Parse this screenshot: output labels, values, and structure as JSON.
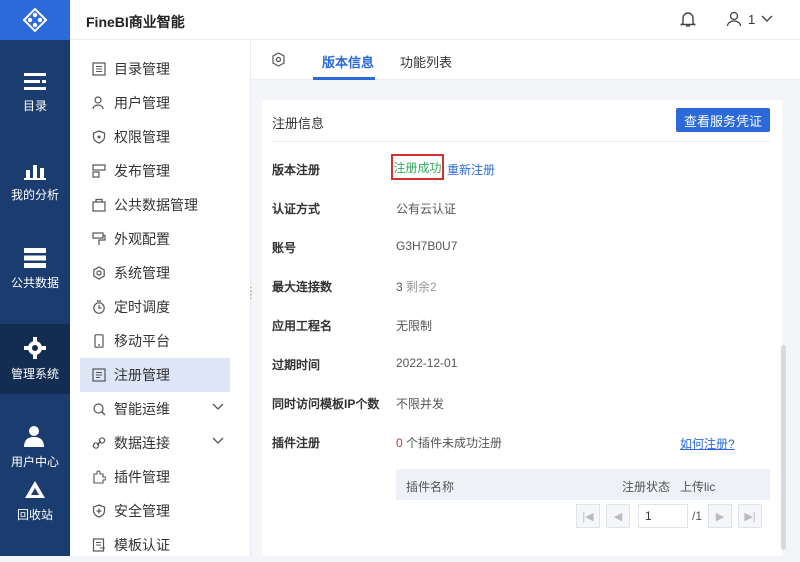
{
  "app": {
    "title": "FineBI商业智能"
  },
  "user": {
    "name": "1"
  },
  "leftbar": {
    "items": [
      {
        "label": "目录"
      },
      {
        "label": "我的分析"
      },
      {
        "label": "公共数据"
      },
      {
        "label": "管理系统"
      },
      {
        "label": "用户中心"
      },
      {
        "label": "回收站"
      }
    ]
  },
  "sidebar": {
    "items": [
      {
        "label": "目录管理"
      },
      {
        "label": "用户管理"
      },
      {
        "label": "权限管理"
      },
      {
        "label": "发布管理"
      },
      {
        "label": "公共数据管理"
      },
      {
        "label": "外观配置"
      },
      {
        "label": "系统管理"
      },
      {
        "label": "定时调度"
      },
      {
        "label": "移动平台"
      },
      {
        "label": "注册管理"
      },
      {
        "label": "智能运维"
      },
      {
        "label": "数据连接"
      },
      {
        "label": "插件管理"
      },
      {
        "label": "安全管理"
      },
      {
        "label": "模板认证"
      }
    ]
  },
  "tabs": {
    "version": "版本信息",
    "features": "功能列表"
  },
  "panel": {
    "heading": "注册信息",
    "view_button": "查看服务凭证",
    "rows": {
      "version_label": "版本注册",
      "version_status": "注册成功",
      "re_register": "重新注册",
      "auth_label": "认证方式",
      "auth_value": "公有云认证",
      "account_label": "账号",
      "account_value": "G3H7B0U7",
      "conn_label": "最大连接数",
      "conn_count": "3",
      "conn_rest": " 剩余2",
      "app_label": "应用工程名",
      "app_value": "无限制",
      "expire_label": "过期时间",
      "expire_value": "2022-12-01",
      "ip_label": "同时访问模板IP个数",
      "ip_value": "不限并发",
      "plugin_label": "插件注册",
      "plugin_count": "0",
      "plugin_text": " 个插件未成功注册",
      "how_link": "如何注册?"
    },
    "table": {
      "col_name": "插件名称",
      "col_status": "注册状态",
      "col_upload": "上传lic"
    },
    "pager": {
      "page": "1",
      "total": "/1"
    }
  },
  "colors": {
    "primary": "#2b6ad8",
    "leftbar": "#1b3c6e",
    "success": "#2faa5a",
    "error": "#d43030"
  }
}
